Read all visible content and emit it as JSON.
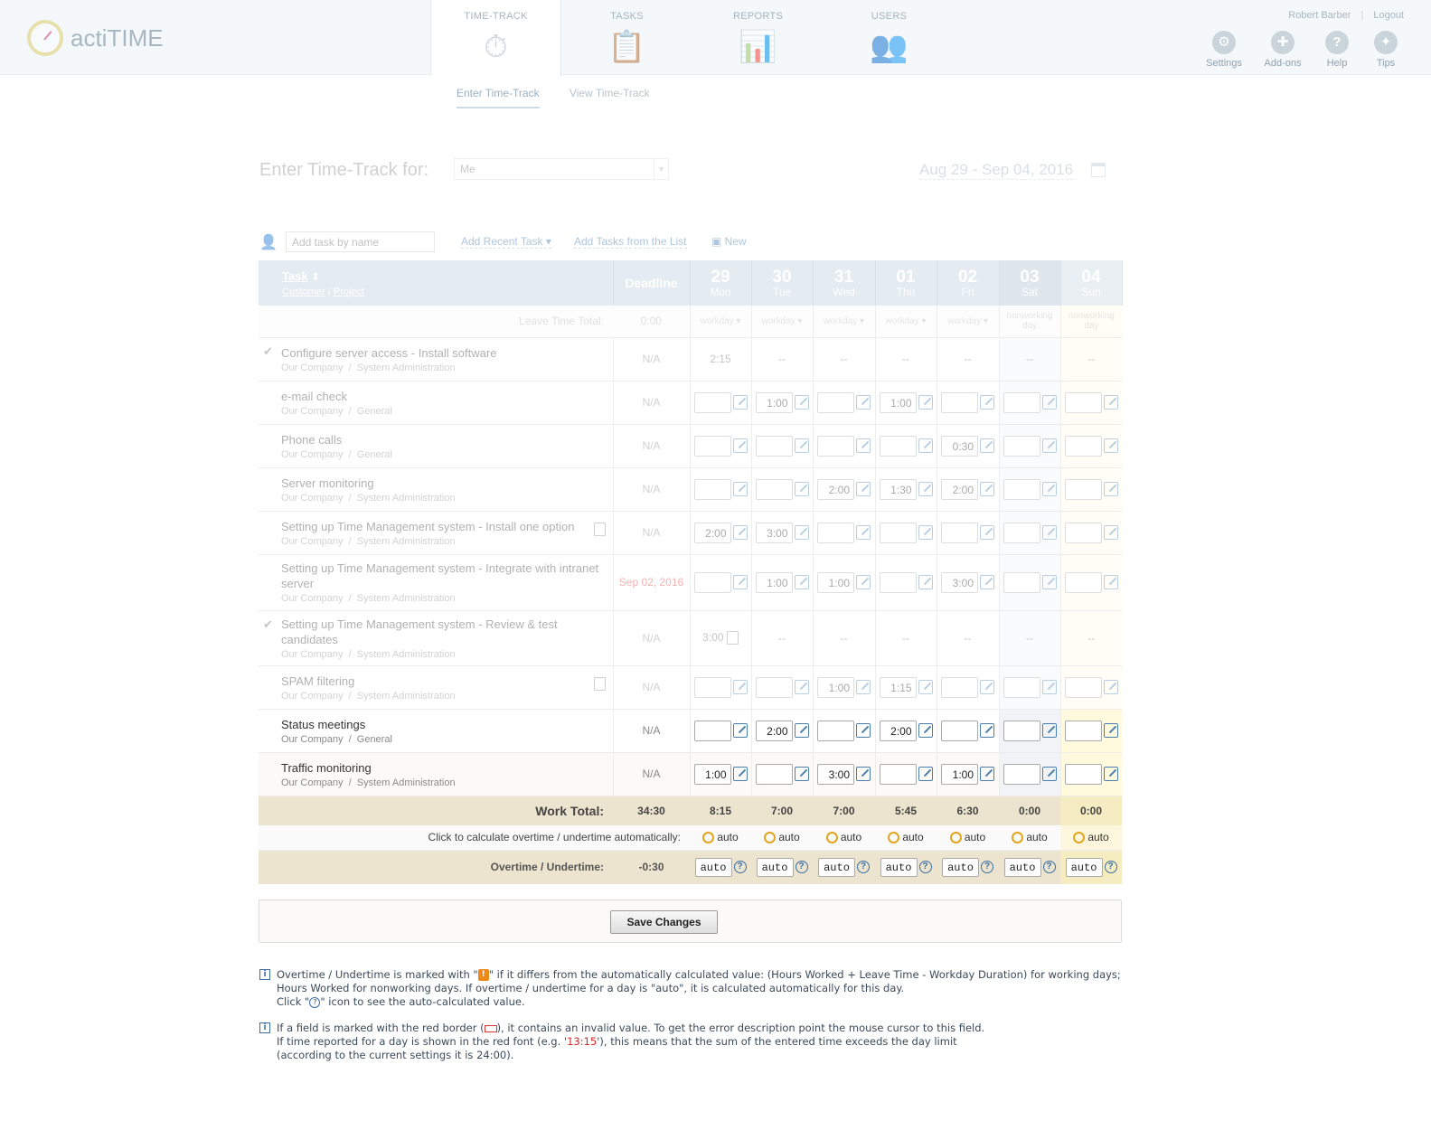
{
  "app": {
    "name": "actiTIME"
  },
  "nav": {
    "tabs": [
      {
        "label": "TIME-TRACK",
        "icon": "stopwatch-icon"
      },
      {
        "label": "TASKS",
        "icon": "clipboard-icon"
      },
      {
        "label": "REPORTS",
        "icon": "chart-icon"
      },
      {
        "label": "USERS",
        "icon": "users-icon"
      }
    ],
    "user": "Robert Barber",
    "logout": "Logout",
    "tools": [
      {
        "label": "Settings",
        "icon": "gear-icon"
      },
      {
        "label": "Add-ons",
        "icon": "puzzle-icon"
      },
      {
        "label": "Help",
        "icon": "help-icon"
      },
      {
        "label": "Tips",
        "icon": "lightbulb-icon"
      }
    ],
    "subtabs": [
      "Enter Time-Track",
      "View Time-Track"
    ]
  },
  "header": {
    "title": "Enter Time-Track for:",
    "user_select": "Me",
    "date_range": "Aug 29 - Sep 04, 2016"
  },
  "toolbar": {
    "add_placeholder": "Add task by name",
    "add_recent": "Add Recent Task",
    "add_from_list": "Add Tasks from the List",
    "new": "New"
  },
  "table": {
    "task_header": "Task",
    "customer": "Customer",
    "project": "Project",
    "deadline_header": "Deadline",
    "days": [
      {
        "num": "29",
        "name": "Mon",
        "type": "workday"
      },
      {
        "num": "30",
        "name": "Tue",
        "type": "workday"
      },
      {
        "num": "31",
        "name": "Wed",
        "type": "workday"
      },
      {
        "num": "01",
        "name": "Thu",
        "type": "workday"
      },
      {
        "num": "02",
        "name": "Fri",
        "type": "workday"
      },
      {
        "num": "03",
        "name": "Sat",
        "type": "nonworking day"
      },
      {
        "num": "04",
        "name": "Sun",
        "type": "nonworking day"
      }
    ],
    "leave_label": "Leave Time Total:",
    "leave_total": "0:00",
    "tasks": [
      {
        "name": "Configure server access - Install software",
        "customer": "Our Company",
        "project": "System Administration",
        "deadline": "N/A",
        "closed": true,
        "values": [
          "2:15",
          "--",
          "--",
          "--",
          "--",
          "--",
          "--"
        ]
      },
      {
        "name": "e-mail check",
        "customer": "Our Company",
        "project": "General",
        "deadline": "N/A",
        "values": [
          "",
          "1:00",
          "",
          "1:00",
          "",
          "",
          ""
        ]
      },
      {
        "name": "Phone calls",
        "customer": "Our Company",
        "project": "General",
        "deadline": "N/A",
        "values": [
          "",
          "",
          "",
          "",
          "0:30",
          "",
          ""
        ]
      },
      {
        "name": "Server monitoring",
        "customer": "Our Company",
        "project": "System Administration",
        "deadline": "N/A",
        "values": [
          "",
          "",
          "2:00",
          "1:30",
          "2:00",
          "",
          ""
        ]
      },
      {
        "name": "Setting up Time Management system - Install one option",
        "customer": "Our Company",
        "project": "System Administration",
        "deadline": "N/A",
        "values": [
          "2:00",
          "3:00",
          "",
          "",
          "",
          "",
          ""
        ]
      },
      {
        "name": "Setting up Time Management system - Integrate with intranet server",
        "customer": "Our Company",
        "project": "System Administration",
        "deadline": "Sep 02, 2016",
        "values": [
          "",
          "1:00",
          "1:00",
          "",
          "3:00",
          "",
          ""
        ]
      },
      {
        "name": "Setting up Time Management system - Review & test candidates",
        "customer": "Our Company",
        "project": "System Administration",
        "deadline": "N/A",
        "closed": true,
        "values": [
          "3:00",
          "--",
          "--",
          "--",
          "--",
          "--",
          "--"
        ]
      },
      {
        "name": "SPAM filtering",
        "customer": "Our Company",
        "project": "System Administration",
        "deadline": "N/A",
        "values": [
          "",
          "",
          "1:00",
          "1:15",
          "",
          "",
          ""
        ]
      },
      {
        "name": "Status meetings",
        "customer": "Our Company",
        "project": "General",
        "deadline": "N/A",
        "values": [
          "",
          "2:00",
          "",
          "2:00",
          "",
          "",
          ""
        ]
      },
      {
        "name": "Traffic monitoring",
        "customer": "Our Company",
        "project": "System Administration",
        "deadline": "N/A",
        "values": [
          "1:00",
          "",
          "3:00",
          "",
          "1:00",
          "",
          ""
        ]
      }
    ],
    "work_total_label": "Work Total:",
    "work_total": "34:30",
    "day_totals": [
      "8:15",
      "7:00",
      "7:00",
      "5:45",
      "6:30",
      "0:00",
      "0:00"
    ],
    "auto_label": "Click to calculate overtime / undertime automatically:",
    "auto_text": "auto",
    "overtime_label": "Overtime / Undertime:",
    "overtime_total": "-0:30",
    "overtime_values": [
      "auto",
      "auto",
      "auto",
      "auto",
      "auto",
      "auto",
      "auto"
    ],
    "help_mark": "?"
  },
  "save_label": "Save Changes",
  "notes": {
    "n1a": "Overtime / Undertime is marked with \"",
    "n1b": "\" if it differs from the automatically calculated value: (Hours Worked + Leave Time - Workday Duration) for working days;",
    "n1c": "Hours Worked for nonworking days. If overtime / undertime for a day is \"auto\", it is calculated automatically for this day.",
    "n1d": "Click \"",
    "n1e": "\" icon to see the auto-calculated value.",
    "n2a": "If a field is marked with the red border (",
    "n2b": "), it contains an invalid value. To get the error description point the mouse cursor to this field.",
    "n2c": "If time reported for a day is shown in the red font (e.g. '",
    "n2d": "13:15",
    "n2e": "'), this means that the sum of the entered time exceeds the day limit",
    "n2f": "(according to the current settings it is 24:00)."
  },
  "colors": {
    "header": "#c4d4e2",
    "total_row": "#ece4cf",
    "link": "#4a7fb0",
    "deadline_red": "#d33"
  }
}
